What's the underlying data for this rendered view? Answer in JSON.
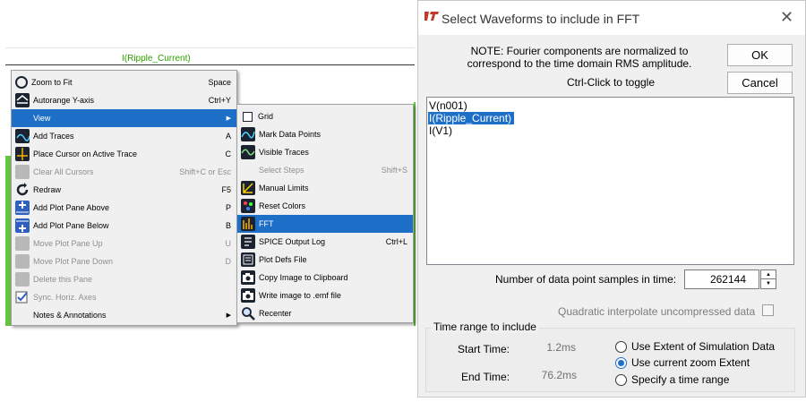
{
  "plot": {
    "trace_title": "I(Ripple_Current)",
    "trace_color": "#2fa000"
  },
  "context_menu": {
    "items": [
      {
        "label": "Zoom to Fit",
        "shortcut": "Space",
        "icon": "zoom-fit-icon",
        "disabled": false
      },
      {
        "label": "Autorange Y-axis",
        "shortcut": "Ctrl+Y",
        "icon": "autorange-icon",
        "disabled": false
      },
      {
        "label": "View",
        "shortcut": "",
        "icon": "",
        "disabled": false,
        "highlighted": true,
        "submenu": true
      },
      {
        "label": "Add Traces",
        "shortcut": "A",
        "icon": "add-traces-icon",
        "disabled": false
      },
      {
        "label": "Place Cursor on Active Trace",
        "shortcut": "C",
        "icon": "cursor-icon",
        "disabled": false
      },
      {
        "label": "Clear All Cursors",
        "shortcut": "Shift+C or Esc",
        "icon": "clear-cursors-icon",
        "disabled": true
      },
      {
        "label": "Redraw",
        "shortcut": "F5",
        "icon": "redraw-icon",
        "disabled": false
      },
      {
        "label": "Add Plot Pane Above",
        "shortcut": "P",
        "icon": "add-pane-above-icon",
        "disabled": false
      },
      {
        "label": "Add Plot Pane Below",
        "shortcut": "B",
        "icon": "add-pane-below-icon",
        "disabled": false
      },
      {
        "label": "Move Plot Pane Up",
        "shortcut": "U",
        "icon": "move-pane-up-icon",
        "disabled": true
      },
      {
        "label": "Move Plot Pane Down",
        "shortcut": "D",
        "icon": "move-pane-down-icon",
        "disabled": true
      },
      {
        "label": "Delete this Pane",
        "shortcut": "",
        "icon": "delete-pane-icon",
        "disabled": true
      },
      {
        "label": "Sync. Horiz. Axes",
        "shortcut": "",
        "icon": "sync-axes-icon",
        "disabled": true
      },
      {
        "label": "Notes & Annotations",
        "shortcut": "",
        "icon": "",
        "disabled": false,
        "submenu": true
      }
    ]
  },
  "view_submenu": {
    "items": [
      {
        "label": "Grid",
        "shortcut": "",
        "icon": "grid-checkbox-icon",
        "disabled": false
      },
      {
        "label": "Mark Data Points",
        "shortcut": "",
        "icon": "mark-points-icon",
        "disabled": false
      },
      {
        "label": "Visible Traces",
        "shortcut": "",
        "icon": "visible-traces-icon",
        "disabled": false
      },
      {
        "label": "Select Steps",
        "shortcut": "Shift+S",
        "icon": "",
        "disabled": true
      },
      {
        "label": "Manual Limits",
        "shortcut": "",
        "icon": "manual-limits-icon",
        "disabled": false
      },
      {
        "label": "Reset Colors",
        "shortcut": "",
        "icon": "reset-colors-icon",
        "disabled": false
      },
      {
        "label": "FFT",
        "shortcut": "",
        "icon": "fft-icon",
        "disabled": false,
        "highlighted": true
      },
      {
        "label": "SPICE Output Log",
        "shortcut": "Ctrl+L",
        "icon": "spice-log-icon",
        "disabled": false
      },
      {
        "label": "Plot Defs File",
        "shortcut": "",
        "icon": "plot-defs-icon",
        "disabled": false
      },
      {
        "label": "Copy Image to Clipboard",
        "shortcut": "",
        "icon": "camera-icon",
        "disabled": false
      },
      {
        "label": "Write image to .emf file",
        "shortcut": "",
        "icon": "camera-icon",
        "disabled": false
      },
      {
        "label": "Recenter",
        "shortcut": "",
        "icon": "recenter-icon",
        "disabled": false
      }
    ]
  },
  "dialog": {
    "title": "Select Waveforms to include in FFT",
    "note_line1": "NOTE:  Fourier components are normalized to",
    "note_line2": "correspond to the time domain RMS amplitude.",
    "toggle_hint": "Ctrl-Click to toggle",
    "ok_label": "OK",
    "cancel_label": "Cancel",
    "waveforms": [
      {
        "name": "V(n001)",
        "selected": false
      },
      {
        "name": "I(Ripple_Current)",
        "selected": true
      },
      {
        "name": "I(V1)",
        "selected": false
      }
    ],
    "samples_label": "Number of data point samples in time:",
    "samples_value": "262144",
    "quadratic_label": "Quadratic interpolate uncompressed data",
    "quadratic_checked": false,
    "time_range_title": "Time range to include",
    "start_time_label": "Start Time:",
    "start_time_value": "1.2ms",
    "end_time_label": "End Time:",
    "end_time_value": "76.2ms",
    "range_options": [
      {
        "label": "Use Extent of Simulation Data",
        "checked": false
      },
      {
        "label": "Use current zoom Extent",
        "checked": true
      },
      {
        "label": "Specify a time range",
        "checked": false
      }
    ],
    "selection_color": "#1e6fc7"
  }
}
